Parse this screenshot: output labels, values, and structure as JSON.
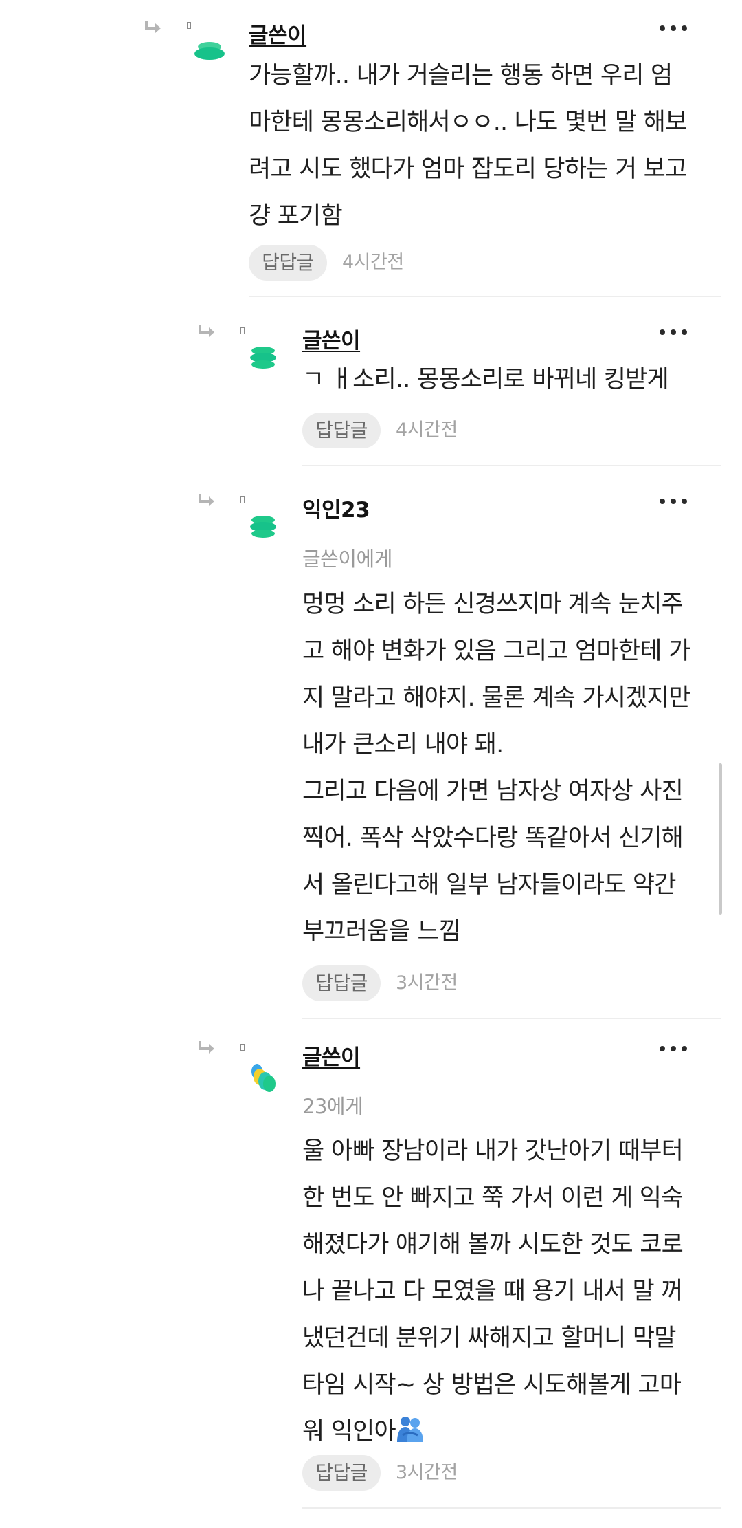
{
  "comments": [
    {
      "author": "글쓴이",
      "recipient": "",
      "text": "가능할까.. 내가 거슬리는 행동 하면 우리 엄\n마한테 몽몽소리해서ㅇㅇ.. 나도 몇번 말 해보\n려고 시도 했다가 엄마 잡도리 당하는 거 보고\n걍 포기함",
      "reply_label": "답답글",
      "time": "4시간전"
    },
    {
      "author": "글쓴이",
      "recipient": "",
      "text": "ㄱ ㅐ소리.. 몽몽소리로 바뀌네 킹받게",
      "reply_label": "답답글",
      "time": "4시간전"
    },
    {
      "author": "익인23",
      "recipient": "글쓴이에게",
      "text": "멍멍 소리 하든 신경쓰지마 계속 눈치주\n고 해야 변화가 있음 그리고 엄마한테 가\n지 말라고 해야지. 물론 계속 가시겠지만\n내가 큰소리 내야 돼.\n그리고 다음에 가면 남자상 여자상 사진\n찍어. 폭삭 삭았수다랑 똑같아서 신기해\n서 올린다고해 일부 남자들이라도 약간\n부끄러움을 느낌",
      "reply_label": "답답글",
      "time": "3시간전"
    },
    {
      "author": "글쓴이",
      "recipient": "23에게",
      "text": "울 아빠 장남이라 내가 갓난아기 때부터\n한 번도 안 빠지고 쭉 가서 이런 게 익숙\n해졌다가 얘기해 볼까 시도한 것도 코로\n나 끝나고 다 모였을 때 용기 내서 말 꺼\n냈던건데 분위기 싸해지고 할머니 막말\n타임 시작~ 상 방법은 시도해볼게 고마\n워 익인아",
      "reply_label": "답답글",
      "time": "3시간전"
    }
  ],
  "icons": {
    "reply_arrow": "reply-arrow-icon",
    "more": "more-options-icon",
    "emoji": "people-hugging-emoji"
  },
  "colors": {
    "avatar_green": "#1fc98a",
    "avatar_teal": "#29c7b0",
    "avatar_yellow": "#f2cf2e",
    "avatar_blue": "#3aa6e8",
    "divider": "#ededed",
    "reply_button_bg": "#ececec"
  }
}
